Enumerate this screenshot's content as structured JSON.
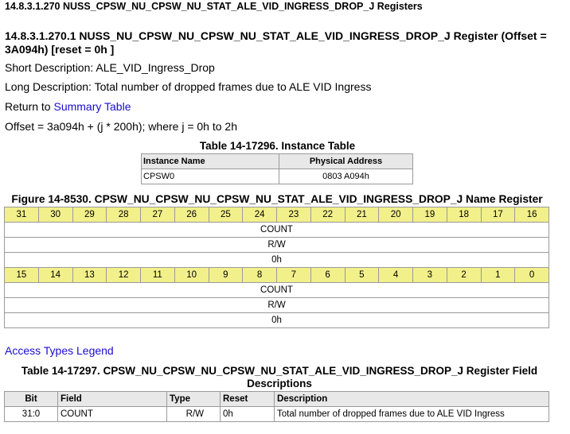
{
  "section_title": "14.8.3.1.270 NUSS_CPSW_NU_CPSW_NU_STAT_ALE_VID_INGRESS_DROP_J Registers",
  "register_title": "14.8.3.1.270.1 NUSS_NU_CPSW_NU_CPSW_NU_STAT_ALE_VID_INGRESS_DROP_J Register (Offset = 3A094h) [reset = 0h ]",
  "short_description": "Short Description: ALE_VID_Ingress_Drop",
  "long_description": "Long Description: Total number of dropped frames due to ALE VID Ingress",
  "return_prefix": "Return to ",
  "return_link": "Summary Table",
  "offset_text": "Offset = 3a094h + (j * 200h); where j = 0h to 2h",
  "instance_table": {
    "caption": "Table 14-17296. Instance Table",
    "headers": [
      "Instance Name",
      "Physical Address"
    ],
    "rows": [
      [
        "CPSW0",
        "0803 A094h"
      ]
    ]
  },
  "register_figure": {
    "caption": "Figure 14-8530. CPSW_NU_CPSW_NU_CPSW_NU_STAT_ALE_VID_INGRESS_DROP_J Name Register",
    "upper_bits": [
      "31",
      "30",
      "29",
      "28",
      "27",
      "26",
      "25",
      "24",
      "23",
      "22",
      "21",
      "20",
      "19",
      "18",
      "17",
      "16"
    ],
    "lower_bits": [
      "15",
      "14",
      "13",
      "12",
      "11",
      "10",
      "9",
      "8",
      "7",
      "6",
      "5",
      "4",
      "3",
      "2",
      "1",
      "0"
    ],
    "upper_field": {
      "name": "COUNT",
      "access": "R/W",
      "reset": "0h"
    },
    "lower_field": {
      "name": "COUNT",
      "access": "R/W",
      "reset": "0h"
    }
  },
  "access_types_link": "Access Types Legend",
  "field_table": {
    "caption_line1": "Table 14-17297. CPSW_NU_CPSW_NU_CPSW_NU_STAT_ALE_VID_INGRESS_DROP_J Register Field",
    "caption_line2": "Descriptions",
    "headers": [
      "Bit",
      "Field",
      "Type",
      "Reset",
      "Description"
    ],
    "rows": [
      [
        "31:0",
        "COUNT",
        "R/W",
        "0h",
        "Total number of dropped frames due to ALE VID Ingress"
      ]
    ]
  },
  "colors": {
    "bit_header_bg": "#f2f08a",
    "header_bg": "#e8e8e8",
    "link": "#1a0dcc",
    "border": "#9a9a9a"
  }
}
